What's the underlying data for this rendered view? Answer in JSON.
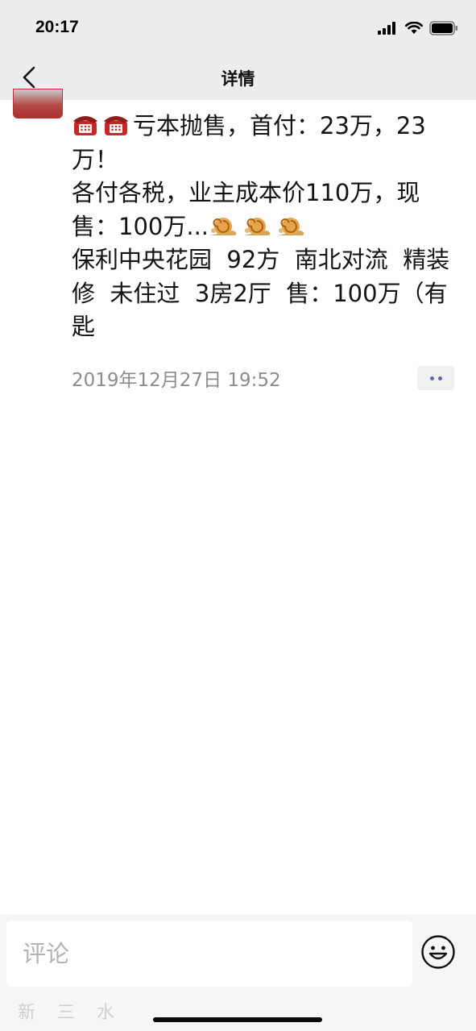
{
  "status_bar": {
    "time": "20:17"
  },
  "nav": {
    "title": "详情"
  },
  "post": {
    "lines": [
      {
        "emoji": [
          "telephone",
          "telephone"
        ],
        "text": "亏本抛售，首付：23万，23万！"
      },
      {
        "text": "各付各税，业主成本价110万，现售：100万...",
        "emoji_after": [
          "snail",
          "snail",
          "snail"
        ]
      },
      {
        "text": "保利中央花园  92方  南北对流  精装修  未住过  3房2厅  售：100万（有匙"
      }
    ],
    "timestamp": "2019年12月27日 19:52"
  },
  "comment": {
    "placeholder": "评论"
  },
  "watermark": "新 三 水",
  "colors": {
    "bar_bg": "#ededed",
    "link_blue": "#56709c",
    "timestamp_gray": "#8c8c8c"
  },
  "icons": {
    "back": "chevron-left-icon",
    "signal": "signal-icon",
    "wifi": "wifi-icon",
    "battery": "battery-icon",
    "more": "more-dots-icon",
    "emoji": "smiley-icon"
  }
}
